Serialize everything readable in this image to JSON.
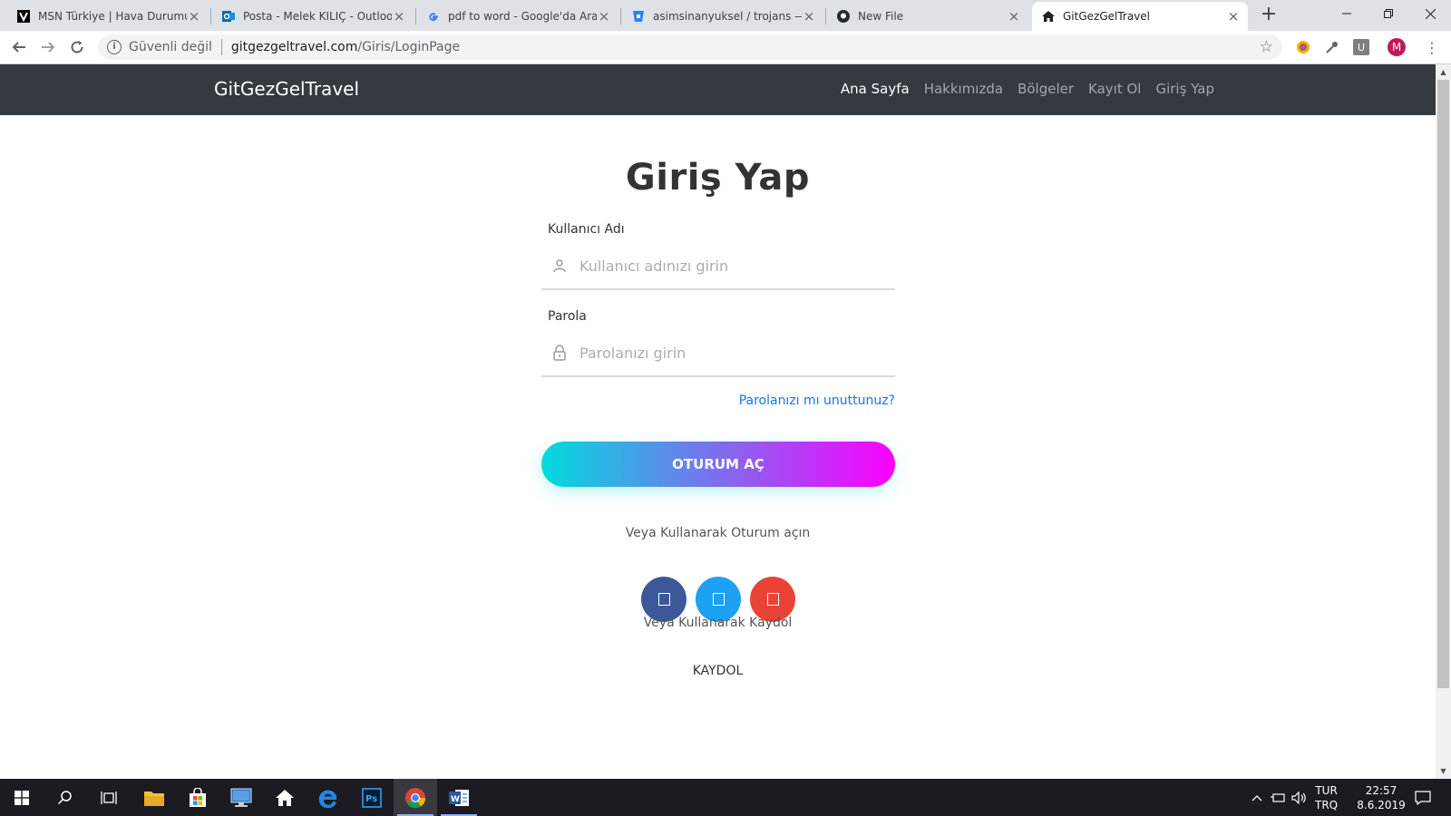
{
  "browser": {
    "tabs": [
      {
        "title": "MSN Türkiye | Hava Durumu, S",
        "icon": "msn-icon"
      },
      {
        "title": "Posta - Melek KILIÇ - Outlook",
        "icon": "outlook-icon"
      },
      {
        "title": "pdf to word - Google'da Ara",
        "icon": "google-icon"
      },
      {
        "title": "asimsinanyuksel / trojans — Bi",
        "icon": "bitbucket-icon"
      },
      {
        "title": "New File",
        "icon": "github-icon"
      },
      {
        "title": "GitGezGelTravel",
        "icon": "home-icon"
      }
    ],
    "security_label": "Güvenli değil",
    "url_host": "gitgezgeltravel.com",
    "url_path": "/Giris/LoginPage",
    "profile_initial": "M",
    "ext_u_label": "U"
  },
  "site": {
    "brand": "GitGezGelTravel",
    "nav": [
      "Ana Sayfa",
      "Hakkımızda",
      "Bölgeler",
      "Kayıt Ol",
      "Giriş Yap"
    ]
  },
  "login": {
    "title": "Giriş Yap",
    "username_label": "Kullanıcı Adı",
    "username_placeholder": "Kullanıcı adınızı girin",
    "password_label": "Parola",
    "password_placeholder": "Parolanızı girin",
    "forgot": "Parolanızı mı unuttunuz?",
    "submit": "OTURUM AÇ",
    "alt_signin": "Veya Kullanarak Oturum açın",
    "alt_signup": "Veya Kullanarak Kaydol",
    "signup": "KAYDOL"
  },
  "taskbar": {
    "lang_top": "TUR",
    "lang_bottom": "TRQ",
    "time": "22:57",
    "date": "8.6.2019"
  },
  "colors": {
    "nav_bg": "#343a40",
    "gradient_start": "#00dbde",
    "gradient_end": "#fc00ff",
    "facebook": "#3b5998",
    "twitter": "#1da1f2",
    "google": "#ea4335",
    "link": "#1a73e8"
  }
}
